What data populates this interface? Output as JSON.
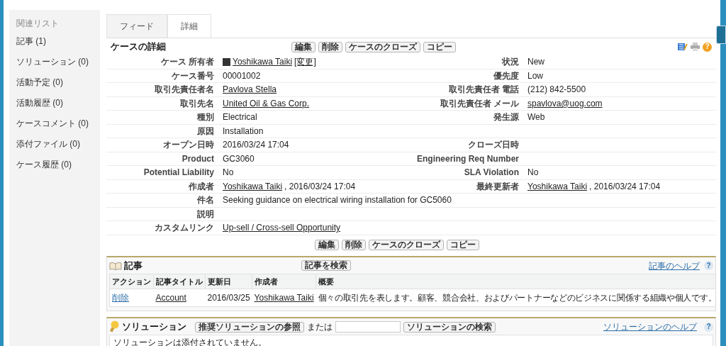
{
  "sidebar": {
    "title": "関連リスト",
    "items": [
      {
        "label": "記事 (1)"
      },
      {
        "label": "ソリューション (0)"
      },
      {
        "label": "活動予定 (0)"
      },
      {
        "label": "活動履歴 (0)"
      },
      {
        "label": "ケースコメント (0)"
      },
      {
        "label": "添付ファイル (0)"
      },
      {
        "label": "ケース履歴 (0)"
      }
    ]
  },
  "page_icons": {
    "help_icon": "?"
  },
  "tabs": [
    {
      "label": "フィード",
      "selected": false
    },
    {
      "label": "詳細",
      "selected": true
    }
  ],
  "detail": {
    "title": "ケースの詳細",
    "buttons": [
      "編集",
      "削除",
      "ケースのクローズ",
      "コピー"
    ],
    "rows": [
      {
        "cells": [
          {
            "label": "ケース 所有者",
            "avatar": true,
            "value": [
              {
                "text": "Yoshikawa Taiki",
                "kind": "link"
              },
              {
                "text": "[変更]",
                "kind": "link"
              }
            ]
          },
          {
            "label": "状況",
            "value": [
              {
                "text": "New",
                "kind": "plain"
              }
            ]
          }
        ]
      },
      {
        "cells": [
          {
            "label": "ケース番号",
            "value": [
              {
                "text": "00001002",
                "kind": "plain"
              }
            ]
          },
          {
            "label": "優先度",
            "value": [
              {
                "text": "Low",
                "kind": "plain"
              }
            ]
          }
        ]
      },
      {
        "cells": [
          {
            "label": "取引先責任者名",
            "value": [
              {
                "text": "Pavlova Stella",
                "kind": "link"
              }
            ]
          },
          {
            "label": "取引先責任者 電話",
            "value": [
              {
                "text": "(212) 842-5500",
                "kind": "plain"
              }
            ]
          }
        ]
      },
      {
        "cells": [
          {
            "label": "取引先名",
            "value": [
              {
                "text": "United Oil & Gas Corp.",
                "kind": "link"
              }
            ]
          },
          {
            "label": "取引先責任者 メール",
            "value": [
              {
                "text": "spavlova@uog.com",
                "kind": "link"
              }
            ]
          }
        ]
      },
      {
        "cells": [
          {
            "label": "種別",
            "value": [
              {
                "text": "Electrical",
                "kind": "plain"
              }
            ]
          },
          {
            "label": "発生源",
            "value": [
              {
                "text": "Web",
                "kind": "plain"
              }
            ]
          }
        ]
      },
      {
        "half": true,
        "cells": [
          {
            "label": "原因",
            "value": [
              {
                "text": "Installation",
                "kind": "plain"
              }
            ]
          }
        ]
      },
      {
        "cells": [
          {
            "label": "オープン日時",
            "value": [
              {
                "text": "2016/03/24 17:04",
                "kind": "plain"
              }
            ]
          },
          {
            "label": "クローズ日時"
          }
        ]
      },
      {
        "cells": [
          {
            "label": "Product",
            "value": [
              {
                "text": "GC3060",
                "kind": "plain"
              }
            ]
          },
          {
            "label": "Engineering Req Number"
          }
        ]
      },
      {
        "cells": [
          {
            "label": "Potential Liability",
            "value": [
              {
                "text": "No",
                "kind": "plain"
              }
            ]
          },
          {
            "label": "SLA Violation",
            "value": [
              {
                "text": "No",
                "kind": "plain"
              }
            ]
          }
        ]
      },
      {
        "cells": [
          {
            "label": "作成者",
            "value": [
              {
                "text": "Yoshikawa Taiki",
                "kind": "link"
              },
              {
                "text": ", 2016/03/24 17:04",
                "kind": "plain"
              }
            ]
          },
          {
            "label": "最終更新者",
            "value": [
              {
                "text": "Yoshikawa Taiki",
                "kind": "link"
              },
              {
                "text": ", 2016/03/24 17:04",
                "kind": "plain"
              }
            ]
          }
        ]
      },
      {
        "cells": [
          {
            "label": "件名",
            "value": [
              {
                "text": "Seeking guidance on electrical wiring installation for GC5060",
                "kind": "plain"
              }
            ]
          }
        ]
      },
      {
        "cells": [
          {
            "label": "説明"
          }
        ]
      },
      {
        "cells": [
          {
            "label": "カスタムリンク",
            "value": [
              {
                "text": "Up-sell / Cross-sell Opportunity",
                "kind": "link"
              }
            ]
          }
        ]
      }
    ],
    "bottom_buttons": [
      "編集",
      "削除",
      "ケースのクローズ",
      "コピー"
    ]
  },
  "articles": {
    "title": "記事",
    "search_button": "記事を検索",
    "help": "記事のヘルプ",
    "help_icon": "?",
    "columns": [
      "アクション",
      "記事タイトル",
      "更新日",
      "作成者",
      "概要"
    ],
    "rows": [
      {
        "action": "削除",
        "title": "Account",
        "updated": "2016/03/25",
        "author": "Yoshikawa Taiki",
        "summary": "個々の取引先を表します。顧客、競合会社、およびパートナーなどのビジネスに関係する組織や個人です。"
      }
    ]
  },
  "solutions": {
    "title": "ソリューション",
    "browse_button": "推奨ソリューションの参照",
    "or": "または",
    "search_button": "ソリューションの検索",
    "help": "ソリューションのヘルプ",
    "help_icon": "?",
    "empty": "ソリューションは添付されていません。"
  }
}
